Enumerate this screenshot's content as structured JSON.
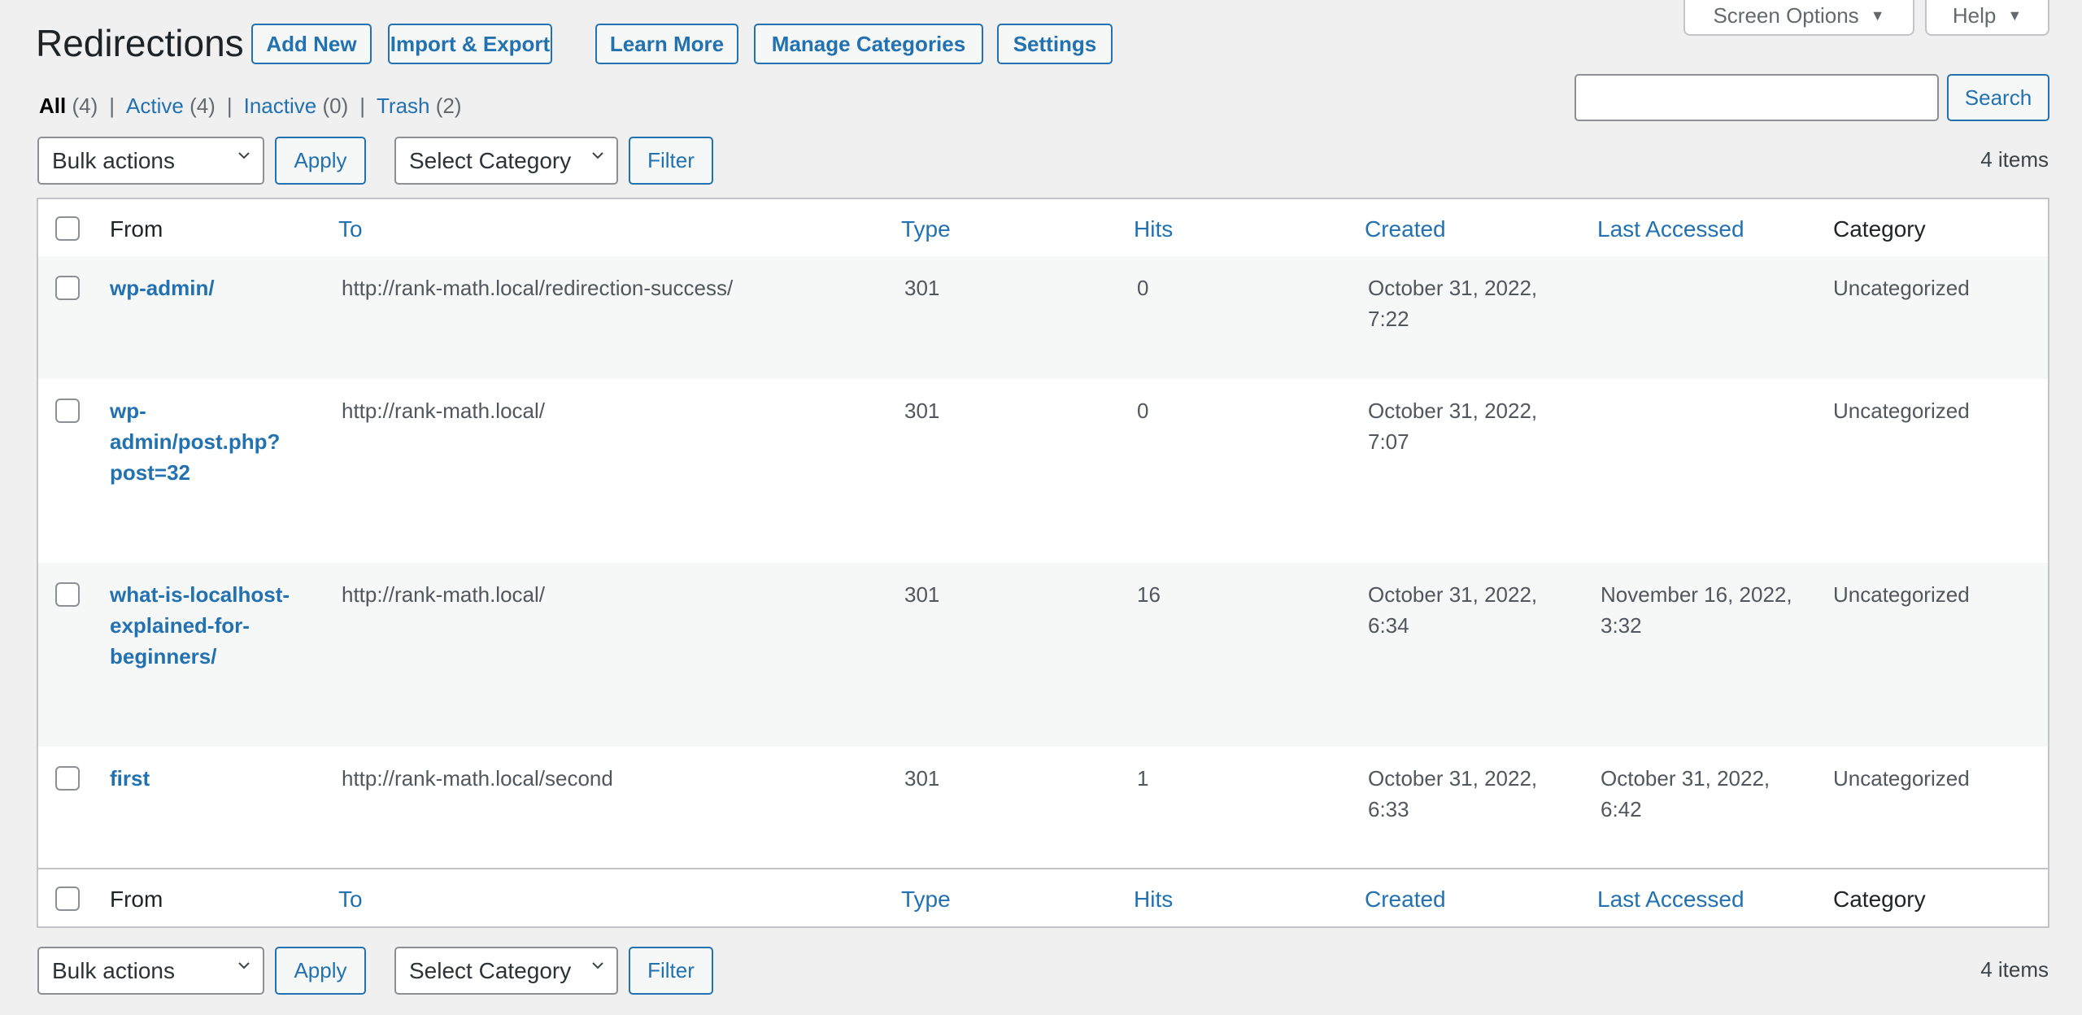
{
  "header": {
    "title": "Redirections",
    "buttons": [
      "Add New",
      "Import & Export",
      "Learn More",
      "Manage Categories",
      "Settings"
    ]
  },
  "screen_meta": {
    "screen_options": "Screen Options",
    "help": "Help",
    "arrow": "▼"
  },
  "views": [
    {
      "label": "All",
      "count": "(4)",
      "current": true
    },
    {
      "label": "Active",
      "count": "(4)",
      "current": false
    },
    {
      "label": "Inactive",
      "count": "(0)",
      "current": false
    },
    {
      "label": "Trash",
      "count": "(2)",
      "current": false
    }
  ],
  "views_separator": "|",
  "search": {
    "value": "",
    "placeholder": "",
    "button": "Search"
  },
  "tablenav": {
    "bulk_actions": "Bulk actions",
    "apply": "Apply",
    "category_select": "Select Category",
    "filter": "Filter",
    "items_count": "4 items"
  },
  "columns": {
    "from": "From",
    "to": "To",
    "type": "Type",
    "hits": "Hits",
    "created": "Created",
    "last_accessed": "Last Accessed",
    "category": "Category"
  },
  "rows": [
    {
      "from": "wp-admin/",
      "to": "http://rank-math.local/redirection-success/",
      "type": "301",
      "hits": "0",
      "created": "October 31, 2022, 7:22",
      "last_accessed": "",
      "category": "Uncategorized"
    },
    {
      "from": "wp-admin/post.php?post=32",
      "to": "http://rank-math.local/",
      "type": "301",
      "hits": "0",
      "created": "October 31, 2022, 7:07",
      "last_accessed": "",
      "category": "Uncategorized"
    },
    {
      "from": "what-is-localhost-explained-for-beginners/",
      "to": "http://rank-math.local/",
      "type": "301",
      "hits": "16",
      "created": "October 31, 2022, 6:34",
      "last_accessed": "November 16, 2022, 3:32",
      "category": "Uncategorized"
    },
    {
      "from": "first",
      "to": "http://rank-math.local/second",
      "type": "301",
      "hits": "1",
      "created": "October 31, 2022, 6:33",
      "last_accessed": "October 31, 2022, 6:42",
      "category": "Uncategorized"
    }
  ],
  "colors": {
    "accent": "#2271b1",
    "background": "#f0f0f1",
    "text": "#3c434a",
    "muted": "#50575e"
  }
}
